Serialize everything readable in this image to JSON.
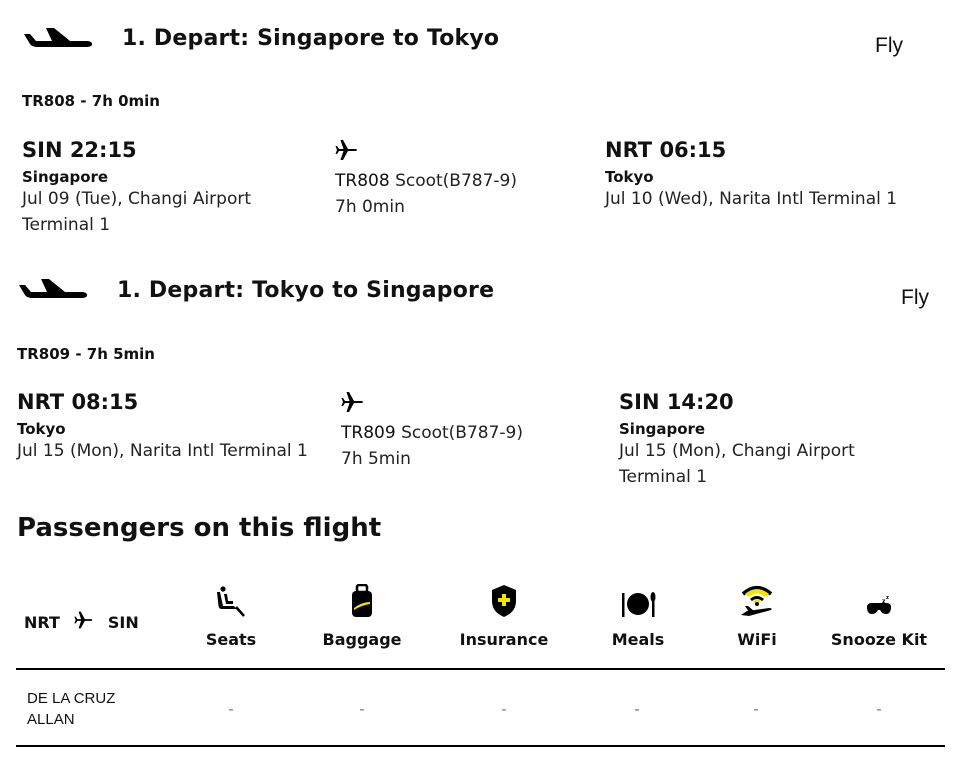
{
  "segments": [
    {
      "title": "1. Depart: Singapore to Tokyo",
      "brand": "Fly",
      "summary": "TR808 - 7h 0min",
      "origin": {
        "code_time": "SIN 22:15",
        "city": "Singapore",
        "detail_line1": "Jul 09 (Tue), Changi Airport",
        "detail_line2": "Terminal 1"
      },
      "middle": {
        "flight_no": "TR808",
        "carrier": "Scoot(B787-9)",
        "duration": "7h 0min"
      },
      "destination": {
        "code_time": "NRT 06:15",
        "city": "Tokyo",
        "detail_line1": "Jul 10 (Wed), Narita Intl Terminal 1",
        "detail_line2": ""
      }
    },
    {
      "title": "1. Depart: Tokyo to Singapore",
      "brand": "Fly",
      "summary": "TR809 - 7h 5min",
      "origin": {
        "code_time": "NRT 08:15",
        "city": "Tokyo",
        "detail_line1": "Jul 15 (Mon), Narita Intl Terminal 1",
        "detail_line2": ""
      },
      "middle": {
        "flight_no": "TR809",
        "carrier": "Scoot(B787-9)",
        "duration": "7h 5min"
      },
      "destination": {
        "code_time": "SIN 14:20",
        "city": "Singapore",
        "detail_line1": "Jul 15 (Mon), Changi Airport",
        "detail_line2": "Terminal 1"
      }
    }
  ],
  "passengers": {
    "title": "Passengers on this flight",
    "route": {
      "from": "NRT",
      "to": "SIN",
      "icon": "airplane-icon"
    },
    "addons": [
      {
        "label": "Seats",
        "icon": "seat-icon"
      },
      {
        "label": "Baggage",
        "icon": "luggage-icon"
      },
      {
        "label": "Insurance",
        "icon": "shield-plus-icon"
      },
      {
        "label": "Meals",
        "icon": "plate-cutlery-icon"
      },
      {
        "label": "WiFi",
        "icon": "wifi-plane-icon"
      },
      {
        "label": "Snooze Kit",
        "icon": "sleep-mask-icon"
      }
    ],
    "rows": [
      {
        "name_line1": "DE LA CRUZ",
        "name_line2": "ALLAN",
        "values": [
          "-",
          "-",
          "-",
          "-",
          "-",
          "-"
        ]
      }
    ]
  },
  "colors": {
    "accent_yellow": "#f5e400",
    "text": "#111111",
    "rule": "#000000"
  }
}
